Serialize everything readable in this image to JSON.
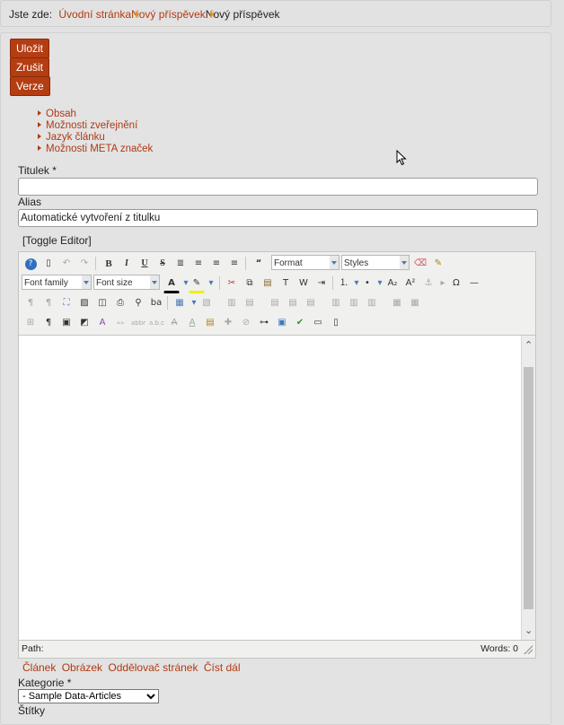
{
  "breadcrumb": {
    "prefix": "Jste zde:",
    "items": [
      "Úvodní stránka",
      "Nový příspěvek",
      "Nový příspěvek"
    ]
  },
  "buttons": {
    "save": "Uložit",
    "cancel": "Zrušit",
    "versions": "Verze"
  },
  "tabs": [
    "Obsah",
    "Možnosti zveřejnění",
    "Jazyk článku",
    "Možnosti META značek"
  ],
  "form": {
    "title_label": "Titulek *",
    "title_value": "",
    "alias_label": "Alias",
    "alias_placeholder": "Automatické vytvoření z titulku",
    "toggle_editor": "[Toggle Editor]"
  },
  "editor": {
    "format_select": "Format",
    "styles_select": "Styles",
    "font_family_select": "Font family",
    "font_size_select": "Font size",
    "path_label": "Path:",
    "words_label": "Words: 0"
  },
  "editor_buttons": [
    "Článek",
    "Obrázek",
    "Oddělovač stránek",
    "Číst dál"
  ],
  "category": {
    "label": "Kategorie *",
    "selected": "- Sample Data-Articles"
  },
  "tags_label": "Štítky",
  "colors": {
    "accent": "#b43d12",
    "link": "#b03a12",
    "breadcrumb_arrow": "#e09020"
  }
}
